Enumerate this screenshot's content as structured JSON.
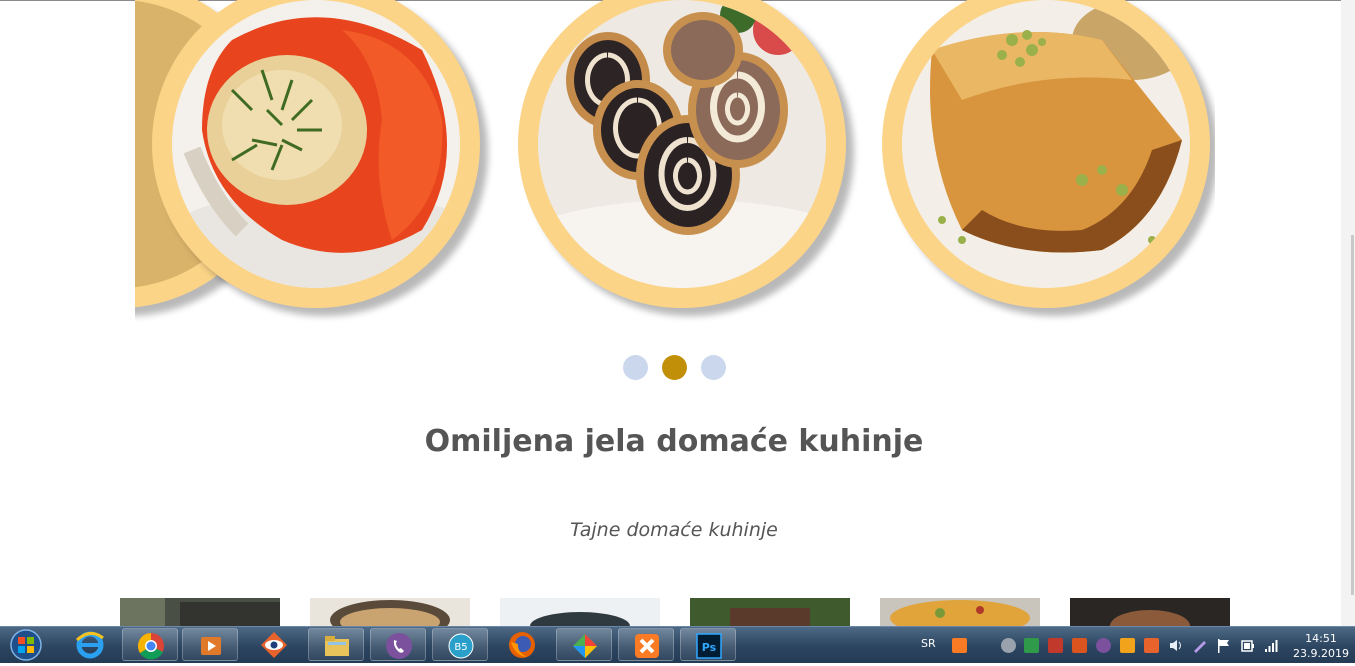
{
  "section": {
    "title": "Omiljena jela domaće kuhinje",
    "subtitle": "Tajne domaće kuhinje"
  },
  "carousel": {
    "slides": [
      "stuffed-pepper",
      "poppy-seed-roll",
      "baklava"
    ],
    "active_index": 1,
    "dot_count": 3
  },
  "colors": {
    "frame": "#fbd488",
    "dot_active": "#c28f09",
    "dot_inactive": "#cad7ec",
    "text": "#555555"
  },
  "taskbar": {
    "apps": [
      "internet-explorer",
      "chrome",
      "media-player",
      "eye-app",
      "file-explorer",
      "viber",
      "b5-app",
      "firefox",
      "colorful-app",
      "xampp",
      "photoshop"
    ],
    "language": "SR",
    "time": "14:51",
    "date": "23.9.2019"
  }
}
